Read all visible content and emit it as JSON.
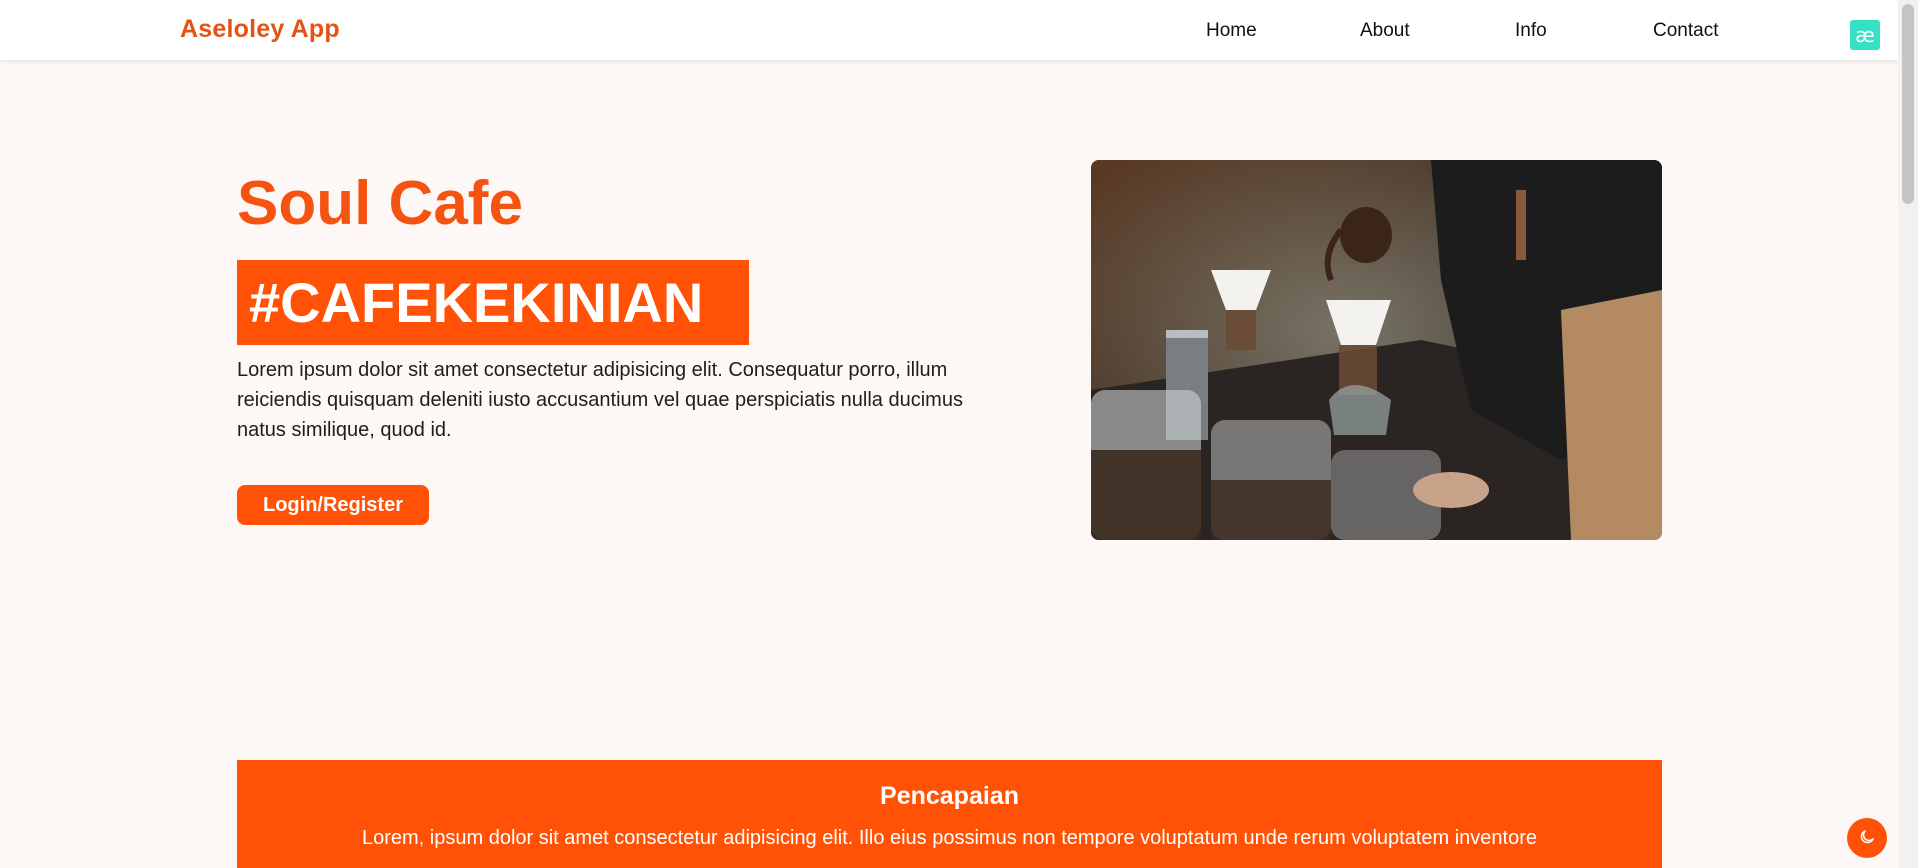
{
  "nav": {
    "brand": "Aseloley App",
    "links": [
      "Home",
      "About",
      "Info",
      "Contact"
    ],
    "logo_glyph": "æ"
  },
  "hero": {
    "title": "Soul Cafe",
    "tag": "#CAFEKEKINIAN",
    "description": "Lorem ipsum dolor sit amet consectetur adipisicing elit. Consequatur porro, illum reiciendis quisquam deleniti iusto accusantium vel quae perspiciatis nulla ducimus natus similique, quod id.",
    "cta_label": "Login/Register"
  },
  "achievements": {
    "title": "Pencapaian",
    "description": "Lorem, ipsum dolor sit amet consectetur adipisicing elit. Illo eius possimus non tempore voluptatum unde rerum voluptatem inventore"
  },
  "icons": {
    "logo": "ae-logo-icon",
    "theme_toggle": "moon-icon"
  },
  "colors": {
    "accent": "#ff5206",
    "brand": "#e35315",
    "background": "#fdf7f5",
    "logo_badge": "#35e0c4"
  }
}
